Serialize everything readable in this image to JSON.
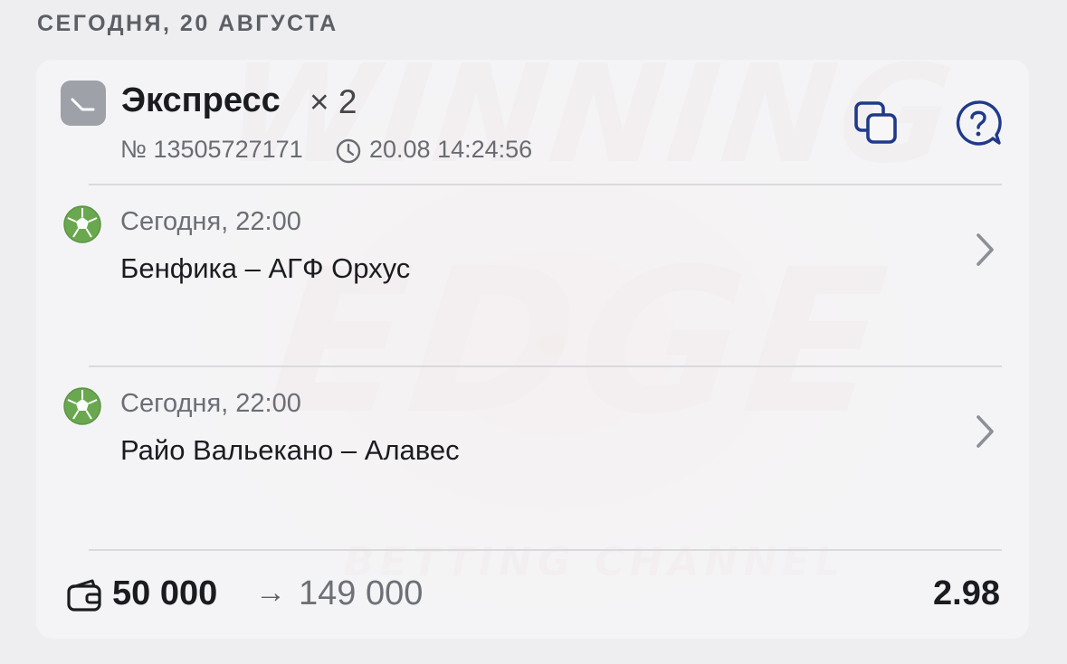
{
  "header": {
    "date_label": "СЕГОДНЯ, 20 АВГУСТА"
  },
  "watermark": {
    "line1": "WINNING",
    "line2": "EDGE",
    "line3": "BETTING CHANNEL"
  },
  "bet": {
    "type": "Экспресс",
    "multiplier": "× 2",
    "number": "№ 13505727171",
    "datetime": "20.08 14:24:56",
    "icons": {
      "type": "clock-icon",
      "copy": "copy-icon",
      "help": "help-icon"
    }
  },
  "events": [
    {
      "time": "Сегодня, 22:00",
      "teams": "Бенфика – АГФ Орхус",
      "sport_icon": "football-icon"
    },
    {
      "time": "Сегодня, 22:00",
      "teams": "Райо Вальекано – Алавес",
      "sport_icon": "football-icon"
    }
  ],
  "footer": {
    "stake": "50 000",
    "arrow": "→",
    "payout": "149 000",
    "odds": "2.98"
  },
  "colors": {
    "accent": "#1f3a8a",
    "football": "#6aa84f",
    "text_primary": "#1b1c20",
    "text_secondary": "#6a6c73"
  }
}
